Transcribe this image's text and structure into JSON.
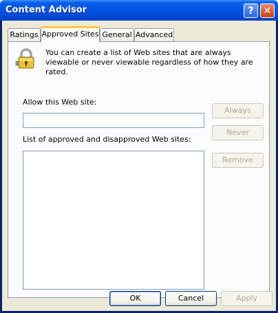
{
  "window": {
    "title": "Content Advisor"
  },
  "titlebar": {
    "help_label": "?",
    "close_label": "✕"
  },
  "tabs": [
    {
      "label": "Ratings"
    },
    {
      "label": "Approved Sites"
    },
    {
      "label": "General"
    },
    {
      "label": "Advanced"
    }
  ],
  "active_tab": "Approved Sites",
  "panel": {
    "description": "You can create a list of Web sites that are always viewable or never viewable regardless of how they are rated.",
    "allow_label": "Allow this Web site:",
    "allow_value": "",
    "list_label": "List of approved and disapproved Web sites:",
    "list_items": [],
    "always_button": "Always",
    "never_button": "Never",
    "remove_button": "Remove"
  },
  "footer": {
    "ok_button": "OK",
    "cancel_button": "Cancel",
    "apply_button": "Apply"
  },
  "icons": {
    "lock": "padlock-icon"
  },
  "colors": {
    "titlebar": "#0055E5",
    "dialog_bg": "#ECE9D8",
    "tab_highlight": "#FFC83C"
  }
}
